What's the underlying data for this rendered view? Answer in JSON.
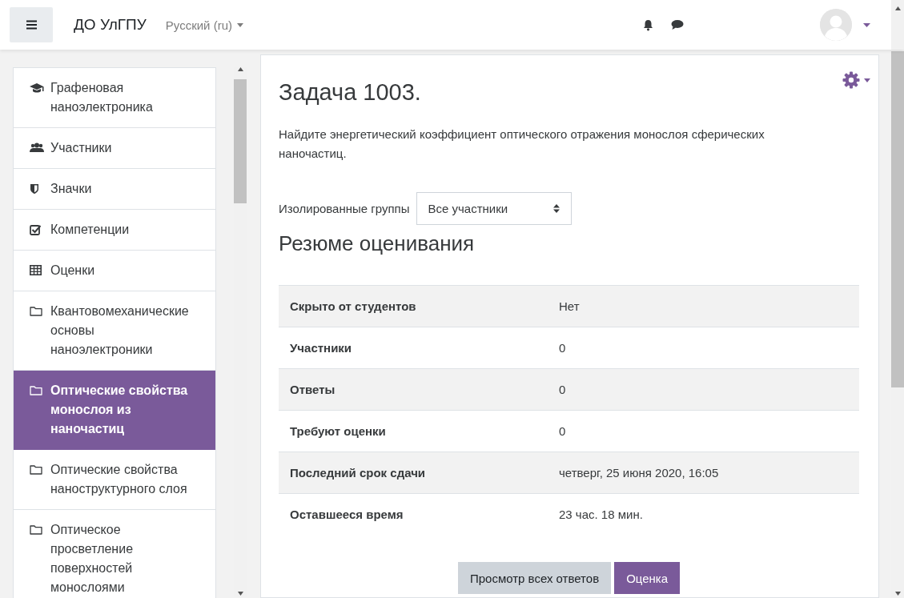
{
  "navbar": {
    "site_name": "ДО УлГПУ",
    "language": "Русский (ru)"
  },
  "sidebar": {
    "items": [
      {
        "kind": "course",
        "label": "Графеновая наноэлектроника",
        "selected": false
      },
      {
        "kind": "participants",
        "label": "Участники",
        "selected": false
      },
      {
        "kind": "badges",
        "label": "Значки",
        "selected": false
      },
      {
        "kind": "competencies",
        "label": "Компетенции",
        "selected": false
      },
      {
        "kind": "grades",
        "label": "Оценки",
        "selected": false
      },
      {
        "kind": "section",
        "label": "Квантовомеханические основы наноэлектроники",
        "selected": false
      },
      {
        "kind": "section",
        "label": "Оптические свойства монослоя из наночастиц",
        "selected": true
      },
      {
        "kind": "section",
        "label": "Оптические свойства наноструктурного слоя",
        "selected": false
      },
      {
        "kind": "section",
        "label": "Оптическое просветление поверхностей монослоями",
        "selected": false
      }
    ]
  },
  "assignment": {
    "title": "Задача 1003.",
    "description": "Найдите энергетический коэффициент оптического отражения монослоя сферических наночастиц.",
    "group_filter": {
      "label": "Изолированные группы",
      "value": "Все участники"
    },
    "summary_heading": "Резюме оценивания",
    "summary": [
      {
        "label": "Скрыто от студентов",
        "value": "Нет"
      },
      {
        "label": "Участники",
        "value": "0"
      },
      {
        "label": "Ответы",
        "value": "0"
      },
      {
        "label": "Требуют оценки",
        "value": "0"
      },
      {
        "label": "Последний срок сдачи",
        "value": "четверг, 25 июня 2020, 16:05"
      },
      {
        "label": "Оставшееся время",
        "value": "23 час. 18 мин."
      }
    ],
    "buttons": [
      {
        "label": "Просмотр всех ответов",
        "kind": "secondary"
      },
      {
        "label": "Оценка",
        "kind": "primary"
      }
    ]
  }
}
